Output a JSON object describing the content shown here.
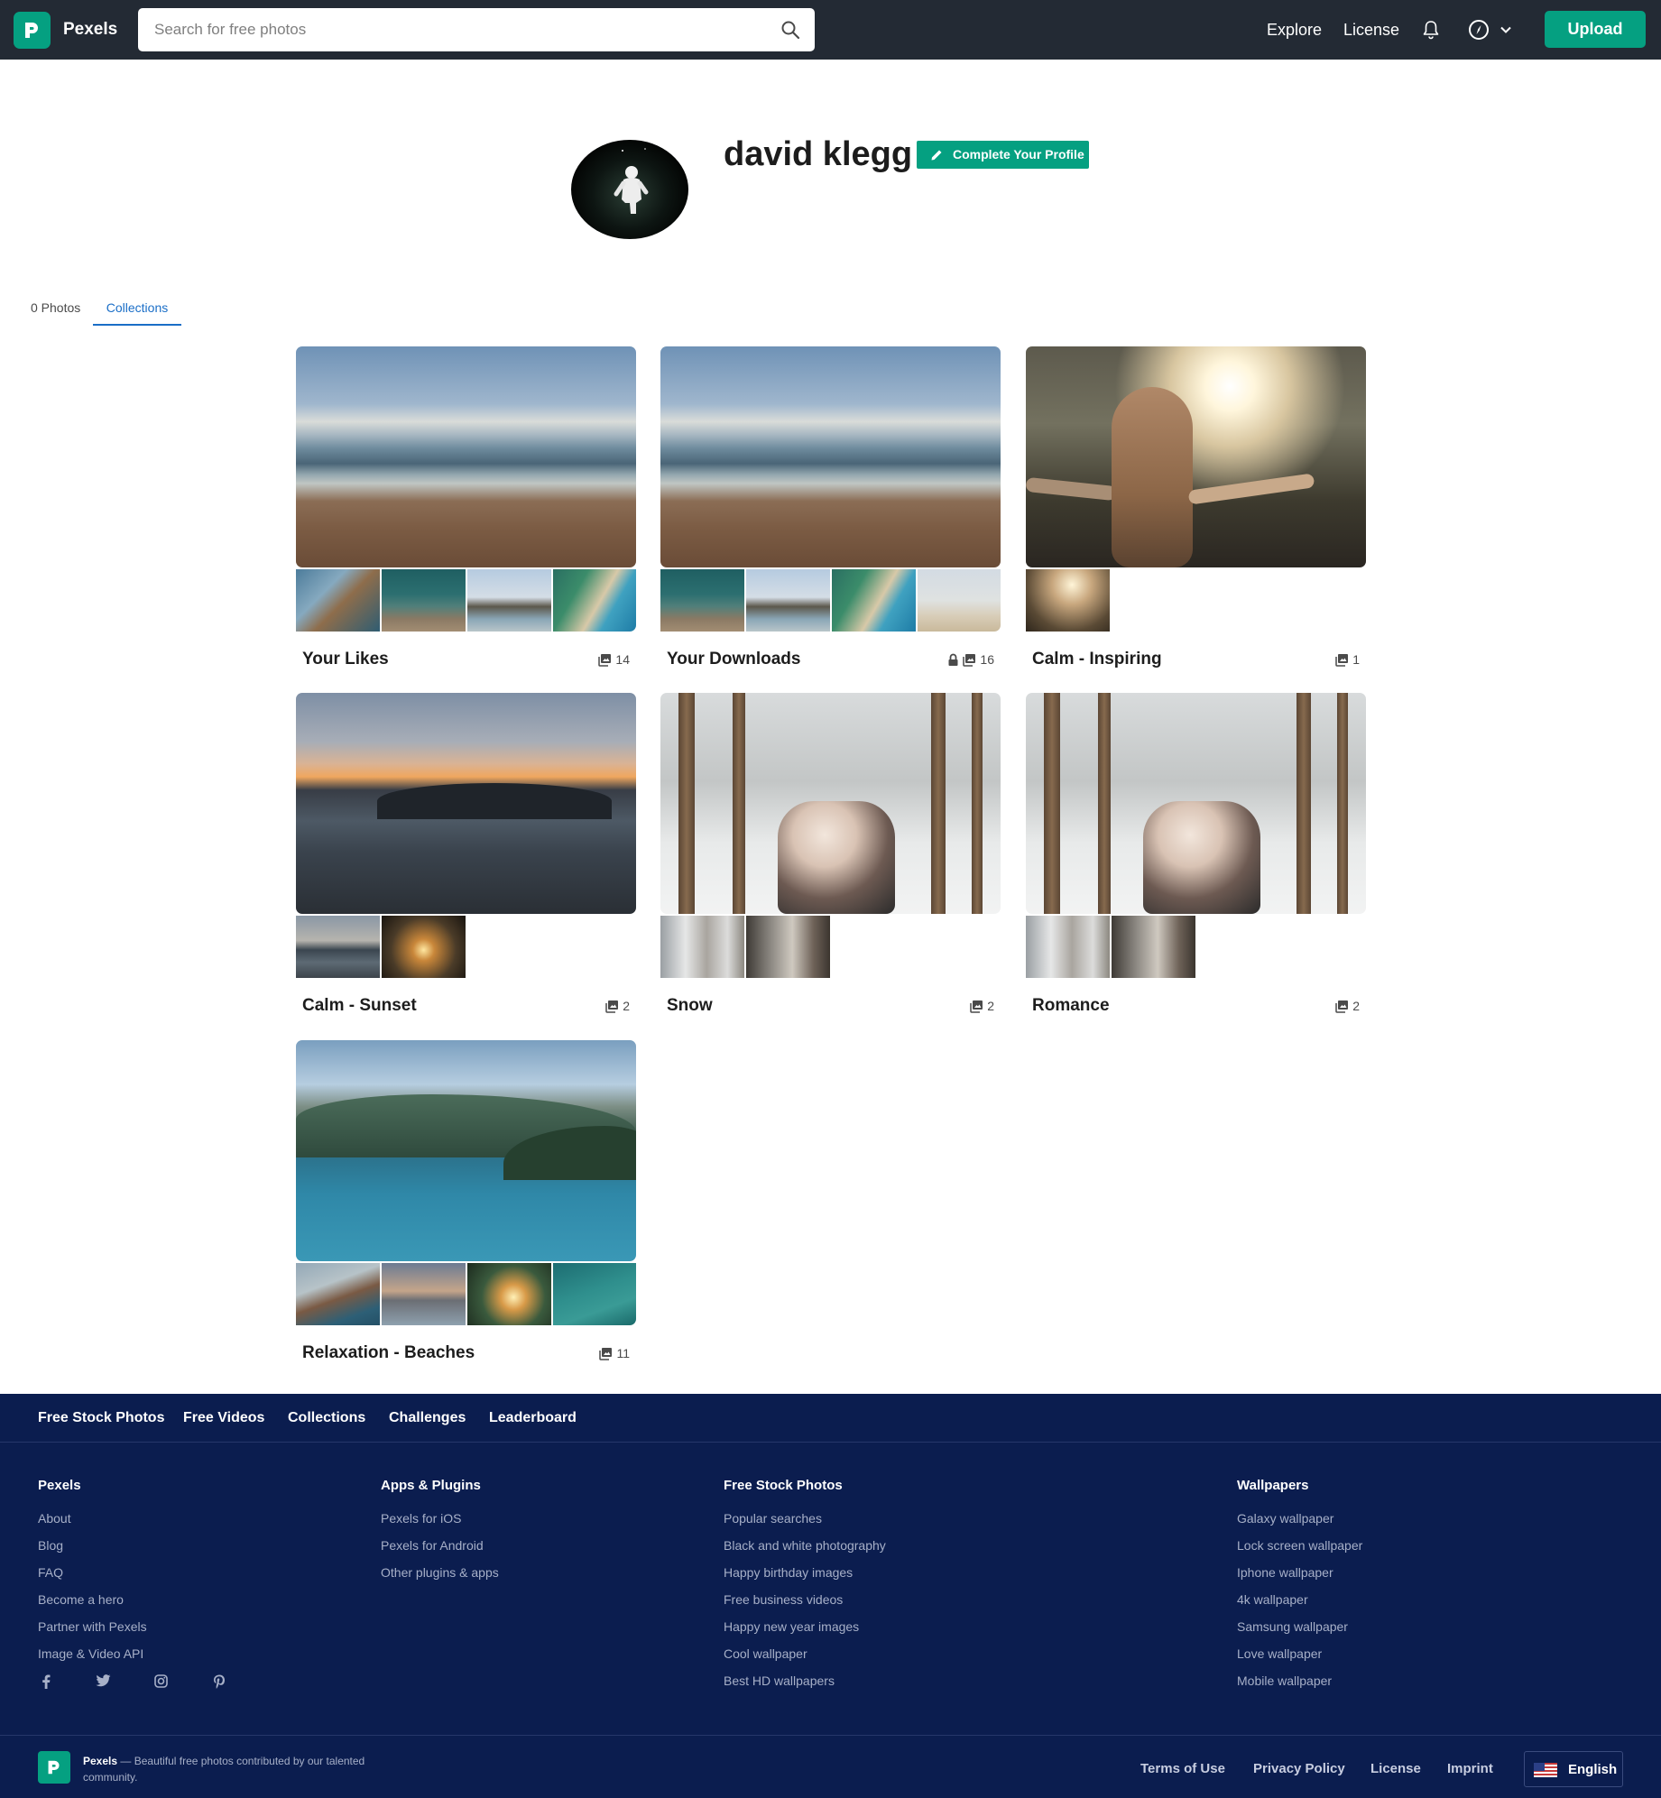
{
  "nav": {
    "brand": "Pexels",
    "search_placeholder": "Search for free photos",
    "explore": "Explore",
    "license": "License",
    "upload": "Upload",
    "icons": [
      "pexels-logo-icon",
      "search-icon",
      "bell-icon",
      "compass-icon",
      "chevron-down-icon"
    ]
  },
  "profile": {
    "name": "david klegg",
    "complete_button": "Complete Your Profile"
  },
  "tabs": [
    {
      "label": "0 Photos",
      "active": false
    },
    {
      "label": "Collections",
      "active": true
    }
  ],
  "collections": [
    {
      "title": "Your Likes",
      "count": "14",
      "private": false
    },
    {
      "title": "Your Downloads",
      "count": "16",
      "private": true
    },
    {
      "title": "Calm - Inspiring",
      "count": "1",
      "private": false
    },
    {
      "title": "Calm - Sunset",
      "count": "2",
      "private": false
    },
    {
      "title": "Snow",
      "count": "2",
      "private": false
    },
    {
      "title": "Romance",
      "count": "2",
      "private": false
    },
    {
      "title": "Relaxation - Beaches",
      "count": "11",
      "private": false
    }
  ],
  "footer": {
    "nav": [
      "Free Stock Photos",
      "Free Videos",
      "Collections",
      "Challenges",
      "Leaderboard"
    ],
    "columns": [
      {
        "heading": "Pexels",
        "links": [
          "About",
          "Blog",
          "FAQ",
          "Become a hero",
          "Partner with Pexels",
          "Image & Video API"
        ]
      },
      {
        "heading": "Apps & Plugins",
        "links": [
          "Pexels for iOS",
          "Pexels for Android",
          "Other plugins & apps"
        ]
      },
      {
        "heading": "Free Stock Photos",
        "links": [
          "Popular searches",
          "Black and white photography",
          "Happy birthday images",
          "Free business videos",
          "Happy new year images",
          "Cool wallpaper",
          "Best HD wallpapers"
        ]
      },
      {
        "heading": "Wallpapers",
        "links": [
          "Galaxy wallpaper",
          "Lock screen wallpaper",
          "Iphone wallpaper",
          "4k wallpaper",
          "Samsung wallpaper",
          "Love wallpaper",
          "Mobile wallpaper"
        ]
      }
    ],
    "social_icons": [
      "facebook-icon",
      "twitter-icon",
      "instagram-icon",
      "pinterest-icon"
    ],
    "tagline_brand": "Pexels",
    "tagline": " — Beautiful free photos contributed by our talented community.",
    "bottom_links": [
      "Terms of Use",
      "Privacy Policy",
      "License",
      "Imprint"
    ],
    "language": "English"
  },
  "colors": {
    "nav_bg": "#232a34",
    "accent": "#05a081",
    "tab_active": "#1a6ec7",
    "footer_bg": "#0b1d4f"
  }
}
